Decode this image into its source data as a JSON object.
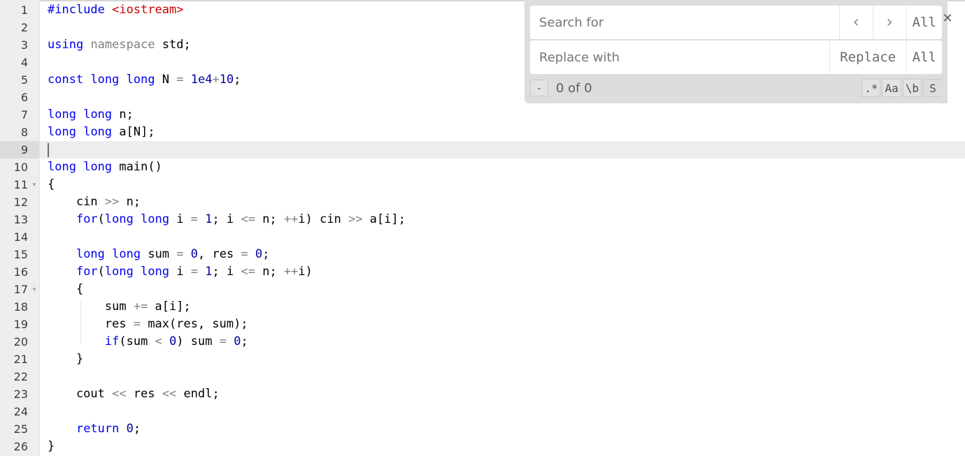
{
  "editor": {
    "language": "cpp",
    "current_line": 9,
    "gutter_bg": "#eeeeee",
    "current_line_gutter_bg": "#dcdcdc",
    "current_line_bg": "#ededed",
    "colors": {
      "keyword": "#0000ee",
      "string": "#cc0000",
      "number": "#00009e",
      "operator": "#808080",
      "plain": "#000000",
      "line_number": "#3b3b3b"
    },
    "lines": [
      {
        "n": "1",
        "fold": "",
        "tokens": [
          {
            "t": "#include",
            "c": "kw"
          },
          {
            "t": " ",
            "c": "pln"
          },
          {
            "t": "<iostream>",
            "c": "str"
          }
        ]
      },
      {
        "n": "2",
        "fold": "",
        "tokens": []
      },
      {
        "n": "3",
        "fold": "",
        "tokens": [
          {
            "t": "using",
            "c": "kw"
          },
          {
            "t": " ",
            "c": "pln"
          },
          {
            "t": "namespace",
            "c": "ns"
          },
          {
            "t": " ",
            "c": "pln"
          },
          {
            "t": "std",
            "c": "pln"
          },
          {
            "t": ";",
            "c": "pln"
          }
        ]
      },
      {
        "n": "4",
        "fold": "",
        "tokens": []
      },
      {
        "n": "5",
        "fold": "",
        "tokens": [
          {
            "t": "const",
            "c": "kw"
          },
          {
            "t": " ",
            "c": "pln"
          },
          {
            "t": "long",
            "c": "kw"
          },
          {
            "t": " ",
            "c": "pln"
          },
          {
            "t": "long",
            "c": "kw"
          },
          {
            "t": " ",
            "c": "pln"
          },
          {
            "t": "N",
            "c": "pln"
          },
          {
            "t": " ",
            "c": "pln"
          },
          {
            "t": "=",
            "c": "op"
          },
          {
            "t": " ",
            "c": "pln"
          },
          {
            "t": "1e4",
            "c": "num"
          },
          {
            "t": "+",
            "c": "op"
          },
          {
            "t": "10",
            "c": "num"
          },
          {
            "t": ";",
            "c": "pln"
          }
        ]
      },
      {
        "n": "6",
        "fold": "",
        "tokens": []
      },
      {
        "n": "7",
        "fold": "",
        "tokens": [
          {
            "t": "long",
            "c": "kw"
          },
          {
            "t": " ",
            "c": "pln"
          },
          {
            "t": "long",
            "c": "kw"
          },
          {
            "t": " ",
            "c": "pln"
          },
          {
            "t": "n;",
            "c": "pln"
          }
        ]
      },
      {
        "n": "8",
        "fold": "",
        "tokens": [
          {
            "t": "long",
            "c": "kw"
          },
          {
            "t": " ",
            "c": "pln"
          },
          {
            "t": "long",
            "c": "kw"
          },
          {
            "t": " ",
            "c": "pln"
          },
          {
            "t": "a[N];",
            "c": "pln"
          }
        ]
      },
      {
        "n": "9",
        "fold": "",
        "tokens": [],
        "current": true,
        "cursor": true
      },
      {
        "n": "10",
        "fold": "",
        "tokens": [
          {
            "t": "long",
            "c": "kw"
          },
          {
            "t": " ",
            "c": "pln"
          },
          {
            "t": "long",
            "c": "kw"
          },
          {
            "t": " ",
            "c": "pln"
          },
          {
            "t": "main()",
            "c": "pln"
          }
        ]
      },
      {
        "n": "11",
        "fold": "▾",
        "tokens": [
          {
            "t": "{",
            "c": "pln"
          }
        ]
      },
      {
        "n": "12",
        "fold": "",
        "tokens": [
          {
            "t": "    cin ",
            "c": "pln"
          },
          {
            "t": ">>",
            "c": "op"
          },
          {
            "t": " n;",
            "c": "pln"
          }
        ]
      },
      {
        "n": "13",
        "fold": "",
        "tokens": [
          {
            "t": "    ",
            "c": "pln"
          },
          {
            "t": "for",
            "c": "kw"
          },
          {
            "t": "(",
            "c": "pln"
          },
          {
            "t": "long",
            "c": "kw"
          },
          {
            "t": " ",
            "c": "pln"
          },
          {
            "t": "long",
            "c": "kw"
          },
          {
            "t": " i ",
            "c": "pln"
          },
          {
            "t": "=",
            "c": "op"
          },
          {
            "t": " ",
            "c": "pln"
          },
          {
            "t": "1",
            "c": "num"
          },
          {
            "t": "; i ",
            "c": "pln"
          },
          {
            "t": "<=",
            "c": "op"
          },
          {
            "t": " n; ",
            "c": "pln"
          },
          {
            "t": "++",
            "c": "op"
          },
          {
            "t": "i) cin ",
            "c": "pln"
          },
          {
            "t": ">>",
            "c": "op"
          },
          {
            "t": " a[i];",
            "c": "pln"
          }
        ]
      },
      {
        "n": "14",
        "fold": "",
        "tokens": []
      },
      {
        "n": "15",
        "fold": "",
        "tokens": [
          {
            "t": "    ",
            "c": "pln"
          },
          {
            "t": "long",
            "c": "kw"
          },
          {
            "t": " ",
            "c": "pln"
          },
          {
            "t": "long",
            "c": "kw"
          },
          {
            "t": " sum ",
            "c": "pln"
          },
          {
            "t": "=",
            "c": "op"
          },
          {
            "t": " ",
            "c": "pln"
          },
          {
            "t": "0",
            "c": "num"
          },
          {
            "t": ", res ",
            "c": "pln"
          },
          {
            "t": "=",
            "c": "op"
          },
          {
            "t": " ",
            "c": "pln"
          },
          {
            "t": "0",
            "c": "num"
          },
          {
            "t": ";",
            "c": "pln"
          }
        ]
      },
      {
        "n": "16",
        "fold": "",
        "tokens": [
          {
            "t": "    ",
            "c": "pln"
          },
          {
            "t": "for",
            "c": "kw"
          },
          {
            "t": "(",
            "c": "pln"
          },
          {
            "t": "long",
            "c": "kw"
          },
          {
            "t": " ",
            "c": "pln"
          },
          {
            "t": "long",
            "c": "kw"
          },
          {
            "t": " i ",
            "c": "pln"
          },
          {
            "t": "=",
            "c": "op"
          },
          {
            "t": " ",
            "c": "pln"
          },
          {
            "t": "1",
            "c": "num"
          },
          {
            "t": "; i ",
            "c": "pln"
          },
          {
            "t": "<=",
            "c": "op"
          },
          {
            "t": " n; ",
            "c": "pln"
          },
          {
            "t": "++",
            "c": "op"
          },
          {
            "t": "i)",
            "c": "pln"
          }
        ]
      },
      {
        "n": "17",
        "fold": "▾",
        "tokens": [
          {
            "t": "    {",
            "c": "pln"
          }
        ]
      },
      {
        "n": "18",
        "fold": "",
        "tokens": [
          {
            "t": "        sum ",
            "c": "pln"
          },
          {
            "t": "+=",
            "c": "op"
          },
          {
            "t": " a[i];",
            "c": "pln"
          }
        ]
      },
      {
        "n": "19",
        "fold": "",
        "tokens": [
          {
            "t": "        res ",
            "c": "pln"
          },
          {
            "t": "=",
            "c": "op"
          },
          {
            "t": " max(res, sum);",
            "c": "pln"
          }
        ]
      },
      {
        "n": "20",
        "fold": "",
        "tokens": [
          {
            "t": "        ",
            "c": "pln"
          },
          {
            "t": "if",
            "c": "kw"
          },
          {
            "t": "(sum ",
            "c": "pln"
          },
          {
            "t": "<",
            "c": "op"
          },
          {
            "t": " ",
            "c": "pln"
          },
          {
            "t": "0",
            "c": "num"
          },
          {
            "t": ") sum ",
            "c": "pln"
          },
          {
            "t": "=",
            "c": "op"
          },
          {
            "t": " ",
            "c": "pln"
          },
          {
            "t": "0",
            "c": "num"
          },
          {
            "t": ";",
            "c": "pln"
          }
        ]
      },
      {
        "n": "21",
        "fold": "",
        "tokens": [
          {
            "t": "    }",
            "c": "pln"
          }
        ]
      },
      {
        "n": "22",
        "fold": "",
        "tokens": []
      },
      {
        "n": "23",
        "fold": "",
        "tokens": [
          {
            "t": "    cout ",
            "c": "pln"
          },
          {
            "t": "<<",
            "c": "op"
          },
          {
            "t": " res ",
            "c": "pln"
          },
          {
            "t": "<<",
            "c": "op"
          },
          {
            "t": " endl;",
            "c": "pln"
          }
        ]
      },
      {
        "n": "24",
        "fold": "",
        "tokens": []
      },
      {
        "n": "25",
        "fold": "",
        "tokens": [
          {
            "t": "    ",
            "c": "pln"
          },
          {
            "t": "return",
            "c": "kw"
          },
          {
            "t": " ",
            "c": "pln"
          },
          {
            "t": "0",
            "c": "num"
          },
          {
            "t": ";",
            "c": "pln"
          }
        ]
      },
      {
        "n": "26",
        "fold": "",
        "tokens": [
          {
            "t": "}",
            "c": "pln"
          }
        ]
      }
    ]
  },
  "search_panel": {
    "search": {
      "value": "",
      "placeholder": "Search for"
    },
    "replace": {
      "value": "",
      "placeholder": "Replace with"
    },
    "find_prev_label": "‹",
    "find_next_label": "›",
    "find_all_label": "All",
    "replace_label": "Replace",
    "replace_all_label": "All",
    "close_label": "✕",
    "status": {
      "dash_label": "-",
      "count_label": "0 of 0"
    },
    "toggles": [
      {
        "label": ".*",
        "name": "regex-toggle"
      },
      {
        "label": "Aa",
        "name": "match-case-toggle"
      },
      {
        "label": "\\b",
        "name": "whole-word-toggle"
      },
      {
        "label": "S",
        "name": "in-selection-toggle"
      }
    ],
    "bg_color": "#dddddd"
  }
}
